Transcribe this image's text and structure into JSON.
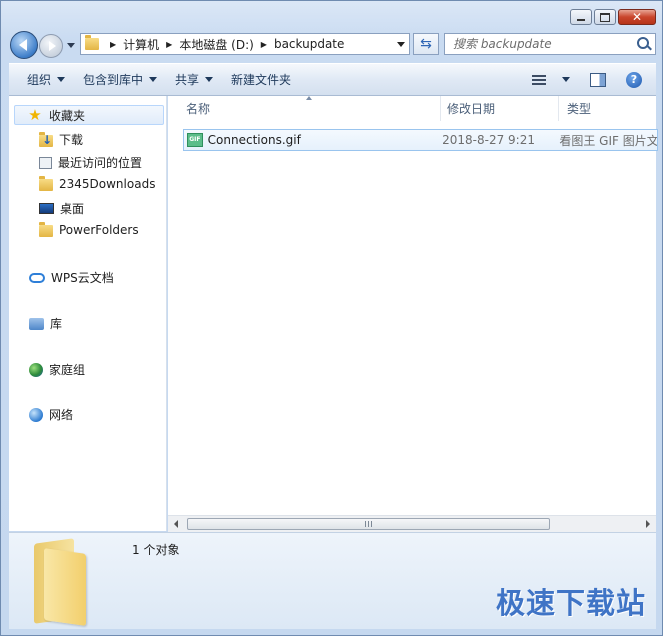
{
  "window": {
    "caption_buttons": {
      "minimize": "",
      "maximize": "",
      "close": "✕"
    }
  },
  "nav": {
    "breadcrumb": [
      "计算机",
      "本地磁盘 (D:)",
      "backupdate"
    ],
    "search_placeholder": "搜索 backupdate"
  },
  "toolbar": {
    "organize": "组织",
    "include_in_library": "包含到库中",
    "share": "共享",
    "new_folder": "新建文件夹"
  },
  "sidebar": {
    "favorites": {
      "label": "收藏夹",
      "items": [
        {
          "label": "下载",
          "icon": "download-folder-icon"
        },
        {
          "label": "最近访问的位置",
          "icon": "recent-places-icon"
        },
        {
          "label": "2345Downloads",
          "icon": "folder-icon"
        },
        {
          "label": "桌面",
          "icon": "desktop-icon"
        },
        {
          "label": "PowerFolders",
          "icon": "folder-icon"
        }
      ]
    },
    "wps_cloud": "WPS云文档",
    "libraries": "库",
    "homegroup": "家庭组",
    "network": "网络"
  },
  "columns": {
    "name": "名称",
    "date_modified": "修改日期",
    "type": "类型"
  },
  "files": [
    {
      "name": "Connections.gif",
      "date": "2018-8-27 9:21",
      "type": "看图王 GIF 图片文件",
      "icon_text": "GIF"
    }
  ],
  "details": {
    "item_count": "1 个对象"
  },
  "watermark": "极速下载站",
  "colors": {
    "accent": "#3f74c6",
    "selection_border": "#99c4ee",
    "window_frame": "#c5d8ef"
  }
}
